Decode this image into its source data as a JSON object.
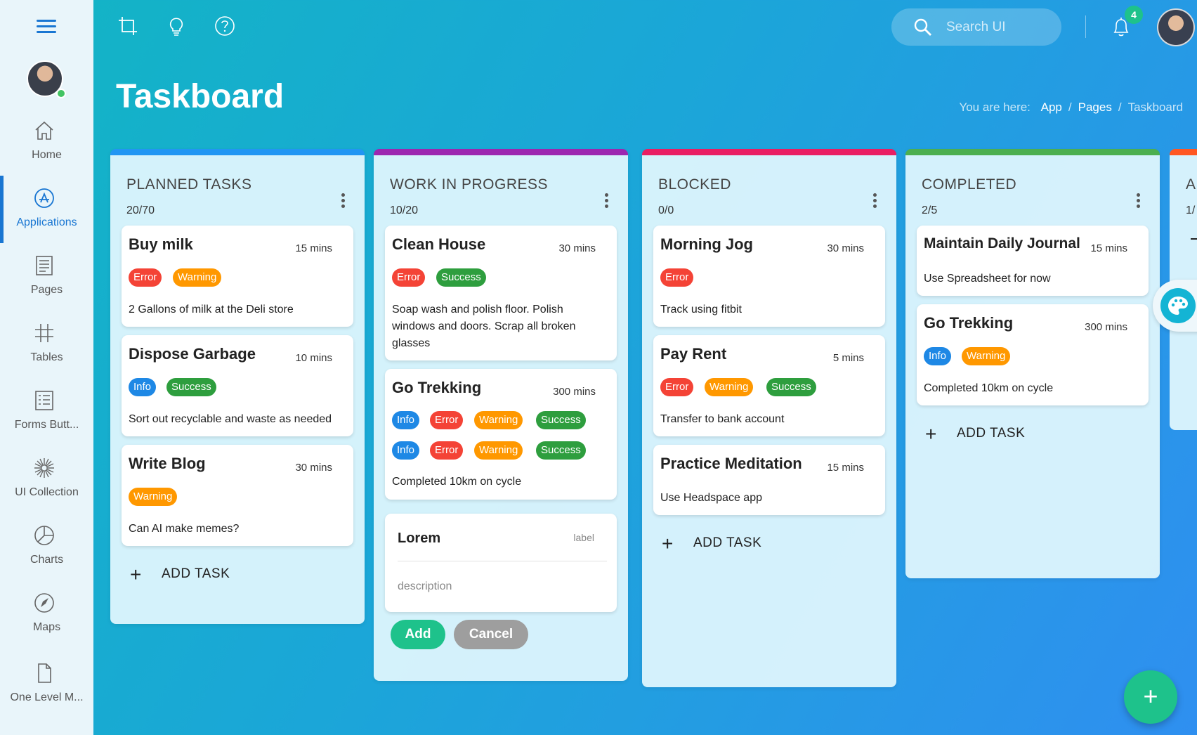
{
  "sidebar": {
    "items": [
      {
        "label": "Home",
        "icon": "home-icon"
      },
      {
        "label": "Applications",
        "icon": "app-store-icon",
        "active": true
      },
      {
        "label": "Pages",
        "icon": "pages-icon"
      },
      {
        "label": "Tables",
        "icon": "hash-icon"
      },
      {
        "label": "Forms Butt...",
        "icon": "form-icon"
      },
      {
        "label": "UI Collection",
        "icon": "flower-icon"
      },
      {
        "label": "Charts",
        "icon": "pie-chart-icon"
      },
      {
        "label": "Maps",
        "icon": "compass-icon"
      },
      {
        "label": "One Level M...",
        "icon": "file-icon"
      }
    ]
  },
  "topbar": {
    "search_placeholder": "Search UI",
    "notification_count": "4"
  },
  "header": {
    "title": "Taskboard",
    "breadcrumb_prefix": "You are here:",
    "breadcrumb": [
      "App",
      "Pages",
      "Taskboard"
    ]
  },
  "colors": {
    "planned": "#2196f3",
    "progress": "#9c27b0",
    "blocked": "#e91e63",
    "completed": "#4caf50",
    "error": "#f44336",
    "warning": "#ff9800",
    "success": "#2e9e3e",
    "info": "#1e88e5",
    "accent": "#1ec28b"
  },
  "columns": [
    {
      "title": "PLANNED TASKS",
      "count": "20/70",
      "add_label": "ADD TASK",
      "cards": [
        {
          "title": "Buy milk",
          "mins": "15 mins",
          "badges": [
            "Error",
            "Warning"
          ],
          "desc": "2 Gallons of milk at the Deli store"
        },
        {
          "title": "Dispose Garbage",
          "mins": "10 mins",
          "badges": [
            "Info",
            "Success"
          ],
          "desc": "Sort out recyclable and waste as needed"
        },
        {
          "title": "Write Blog",
          "mins": "30 mins",
          "badges": [
            "Warning"
          ],
          "desc": "Can AI make memes?"
        }
      ]
    },
    {
      "title": "WORK IN PROGRESS",
      "count": "10/20",
      "cards": [
        {
          "title": "Clean House",
          "mins": "30 mins",
          "badges": [
            "Error",
            "Success"
          ],
          "desc": "Soap wash and polish floor. Polish windows and doors. Scrap all broken glasses"
        },
        {
          "title": "Go Trekking",
          "mins": "300 mins",
          "badges": [
            "Info",
            "Error",
            "Warning",
            "Success",
            "Info",
            "Error",
            "Warning",
            "Success"
          ],
          "desc": "Completed 10km on cycle"
        }
      ],
      "new_task": {
        "title": "Lorem",
        "label": "label",
        "desc_placeholder": "description",
        "add": "Add",
        "cancel": "Cancel"
      }
    },
    {
      "title": "BLOCKED",
      "count": "0/0",
      "add_label": "ADD TASK",
      "cards": [
        {
          "title": "Morning Jog",
          "mins": "30 mins",
          "badges": [
            "Error"
          ],
          "desc": "Track using fitbit"
        },
        {
          "title": "Pay Rent",
          "mins": "5 mins",
          "badges": [
            "Error",
            "Warning",
            "Success"
          ],
          "desc": "Transfer to bank account"
        },
        {
          "title": "Practice Meditation",
          "mins": "15 mins",
          "badges": [],
          "desc": "Use Headspace app"
        }
      ]
    },
    {
      "title": "COMPLETED",
      "count": "2/5",
      "add_label": "ADD TASK",
      "cards": [
        {
          "title": "Maintain Daily Journal",
          "mins": "15 mins",
          "badges": [],
          "desc": "Use Spreadsheet for now"
        },
        {
          "title": "Go Trekking",
          "mins": "300 mins",
          "badges": [
            "Info",
            "Warning"
          ],
          "desc": "Completed 10km on cycle"
        }
      ]
    }
  ],
  "partial_column": {
    "title": "A",
    "count": "1/"
  }
}
